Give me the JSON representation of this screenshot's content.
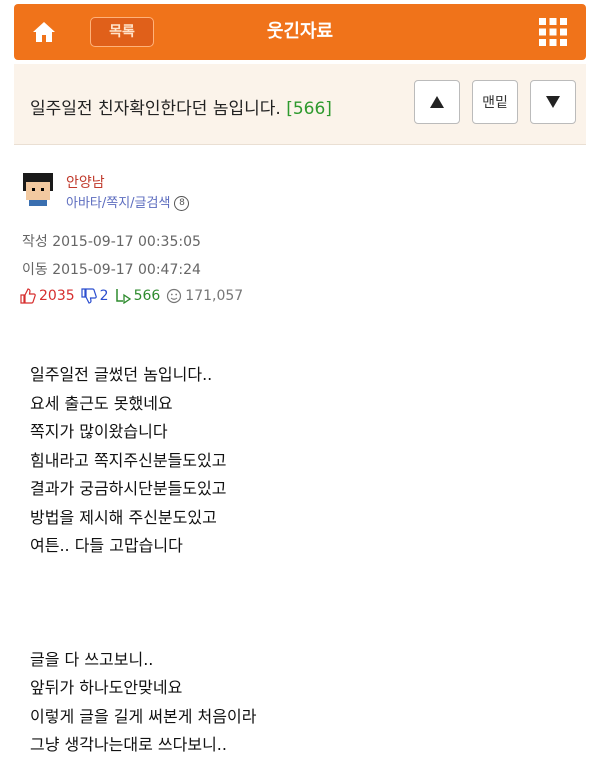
{
  "header": {
    "menu_label": "목록",
    "title": "웃긴자료"
  },
  "post": {
    "subject": "일주일전 친자확인한다던 놈입니다.",
    "comment_count": "[566]",
    "bottom_label": "맨밑",
    "author": "안양남",
    "author_links": "아바타/쪽지/글검색"
  },
  "meta": {
    "written": "작성 2015-09-17 00:35:05",
    "moved": "이동 2015-09-17 00:47:24"
  },
  "stats": {
    "likes": "2035",
    "dislikes": "2",
    "replies": "566",
    "views": "171,057"
  },
  "content": [
    "일주일전 글썼던 놈입니다..",
    "요세 출근도 못했네요",
    "쪽지가 많이왔습니다",
    "힘내라고 쪽지주신분들도있고",
    "결과가 궁금하시단분들도있고",
    "방법을 제시해 주신분도있고",
    "여튼.. 다들 고맙습니다",
    "글을 다 쓰고보니..",
    "앞뒤가 하나도안맞네요",
    "이렇게 글을 길게 써본게 처음이라",
    "그냥 생각나는대로 쓰다보니.."
  ],
  "colors": {
    "brand_orange": "#f0731a",
    "like_red": "#d62e2e",
    "dislike_blue": "#2b4ecf",
    "reply_green": "#2e8b2e"
  }
}
